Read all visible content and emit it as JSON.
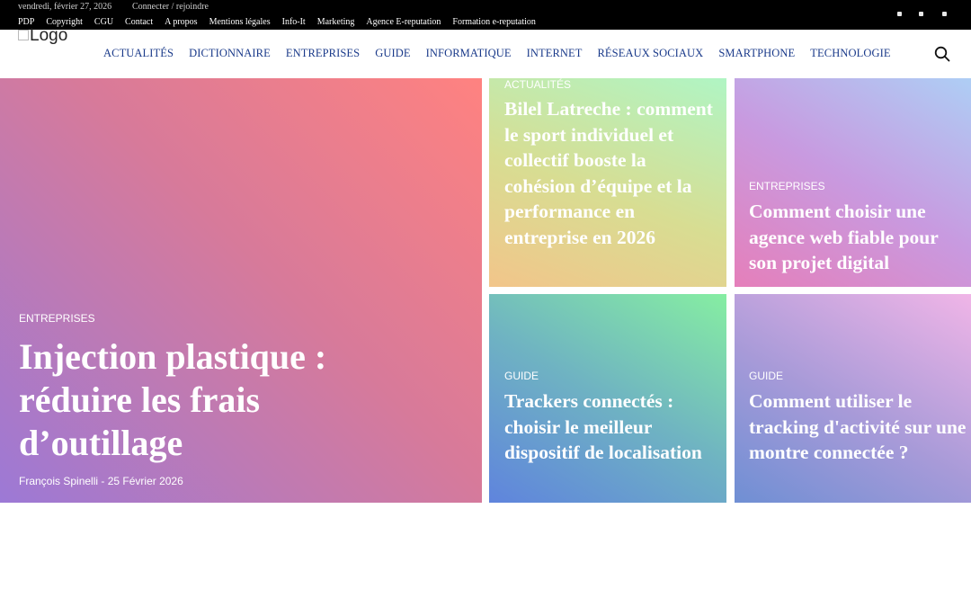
{
  "topbar": {
    "date": "vendredi, février 27, 2026",
    "login": "Connecter / rejoindre",
    "links": [
      "PDP",
      "Copyright",
      "CGU",
      "Contact",
      "A propos",
      "Mentions légales",
      "Info-It",
      "Marketing",
      "Agence E-reputation",
      "Formation e-reputation"
    ]
  },
  "header": {
    "logo_alt": "Logo",
    "nav": [
      "ACTUALITÉS",
      "DICTIONNAIRE",
      "ENTREPRISES",
      "GUIDE",
      "INFORMATIQUE",
      "INTERNET",
      "RÉSEAUX SOCIAUX",
      "SMARTPHONE",
      "TECHNOLOGIE"
    ],
    "search_icon": "search-icon"
  },
  "featured": {
    "main": {
      "category": "ENTREPRISES",
      "title": "Injection plastique : réduire les frais d’outillage",
      "author": "François Spinelli",
      "separator": "-",
      "date": "25 Février 2026"
    },
    "cards": [
      {
        "category": "ACTUALITÉS",
        "title": "Bilel Latreche : comment le sport individuel et collectif booste la cohésion d’équipe et la performance en entreprise en 2026"
      },
      {
        "category": "ENTREPRISES",
        "title": "Comment choisir une agence web fiable pour son projet digital"
      },
      {
        "category": "GUIDE",
        "title": "Trackers connectés : choisir le meilleur dispositif de localisation"
      },
      {
        "category": "GUIDE",
        "title": "Comment utiliser le tracking d'activité sur une montre connectée ?"
      }
    ]
  },
  "colors": {
    "topbar_bg": "#000000",
    "nav_text": "#1a3a8a",
    "card_text": "#ffffff"
  }
}
